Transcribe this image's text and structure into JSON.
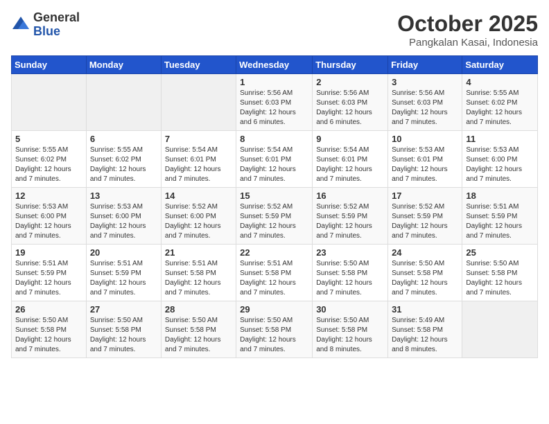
{
  "header": {
    "logo_general": "General",
    "logo_blue": "Blue",
    "month": "October 2025",
    "location": "Pangkalan Kasai, Indonesia"
  },
  "days_of_week": [
    "Sunday",
    "Monday",
    "Tuesday",
    "Wednesday",
    "Thursday",
    "Friday",
    "Saturday"
  ],
  "weeks": [
    [
      {
        "day": "",
        "empty": true
      },
      {
        "day": "",
        "empty": true
      },
      {
        "day": "",
        "empty": true
      },
      {
        "day": "1",
        "sunrise": "5:56 AM",
        "sunset": "6:03 PM",
        "daylight": "12 hours and 6 minutes."
      },
      {
        "day": "2",
        "sunrise": "5:56 AM",
        "sunset": "6:03 PM",
        "daylight": "12 hours and 6 minutes."
      },
      {
        "day": "3",
        "sunrise": "5:56 AM",
        "sunset": "6:03 PM",
        "daylight": "12 hours and 7 minutes."
      },
      {
        "day": "4",
        "sunrise": "5:55 AM",
        "sunset": "6:02 PM",
        "daylight": "12 hours and 7 minutes."
      }
    ],
    [
      {
        "day": "5",
        "sunrise": "5:55 AM",
        "sunset": "6:02 PM",
        "daylight": "12 hours and 7 minutes."
      },
      {
        "day": "6",
        "sunrise": "5:55 AM",
        "sunset": "6:02 PM",
        "daylight": "12 hours and 7 minutes."
      },
      {
        "day": "7",
        "sunrise": "5:54 AM",
        "sunset": "6:01 PM",
        "daylight": "12 hours and 7 minutes."
      },
      {
        "day": "8",
        "sunrise": "5:54 AM",
        "sunset": "6:01 PM",
        "daylight": "12 hours and 7 minutes."
      },
      {
        "day": "9",
        "sunrise": "5:54 AM",
        "sunset": "6:01 PM",
        "daylight": "12 hours and 7 minutes."
      },
      {
        "day": "10",
        "sunrise": "5:53 AM",
        "sunset": "6:01 PM",
        "daylight": "12 hours and 7 minutes."
      },
      {
        "day": "11",
        "sunrise": "5:53 AM",
        "sunset": "6:00 PM",
        "daylight": "12 hours and 7 minutes."
      }
    ],
    [
      {
        "day": "12",
        "sunrise": "5:53 AM",
        "sunset": "6:00 PM",
        "daylight": "12 hours and 7 minutes."
      },
      {
        "day": "13",
        "sunrise": "5:53 AM",
        "sunset": "6:00 PM",
        "daylight": "12 hours and 7 minutes."
      },
      {
        "day": "14",
        "sunrise": "5:52 AM",
        "sunset": "6:00 PM",
        "daylight": "12 hours and 7 minutes."
      },
      {
        "day": "15",
        "sunrise": "5:52 AM",
        "sunset": "5:59 PM",
        "daylight": "12 hours and 7 minutes."
      },
      {
        "day": "16",
        "sunrise": "5:52 AM",
        "sunset": "5:59 PM",
        "daylight": "12 hours and 7 minutes."
      },
      {
        "day": "17",
        "sunrise": "5:52 AM",
        "sunset": "5:59 PM",
        "daylight": "12 hours and 7 minutes."
      },
      {
        "day": "18",
        "sunrise": "5:51 AM",
        "sunset": "5:59 PM",
        "daylight": "12 hours and 7 minutes."
      }
    ],
    [
      {
        "day": "19",
        "sunrise": "5:51 AM",
        "sunset": "5:59 PM",
        "daylight": "12 hours and 7 minutes."
      },
      {
        "day": "20",
        "sunrise": "5:51 AM",
        "sunset": "5:59 PM",
        "daylight": "12 hours and 7 minutes."
      },
      {
        "day": "21",
        "sunrise": "5:51 AM",
        "sunset": "5:58 PM",
        "daylight": "12 hours and 7 minutes."
      },
      {
        "day": "22",
        "sunrise": "5:51 AM",
        "sunset": "5:58 PM",
        "daylight": "12 hours and 7 minutes."
      },
      {
        "day": "23",
        "sunrise": "5:50 AM",
        "sunset": "5:58 PM",
        "daylight": "12 hours and 7 minutes."
      },
      {
        "day": "24",
        "sunrise": "5:50 AM",
        "sunset": "5:58 PM",
        "daylight": "12 hours and 7 minutes."
      },
      {
        "day": "25",
        "sunrise": "5:50 AM",
        "sunset": "5:58 PM",
        "daylight": "12 hours and 7 minutes."
      }
    ],
    [
      {
        "day": "26",
        "sunrise": "5:50 AM",
        "sunset": "5:58 PM",
        "daylight": "12 hours and 7 minutes."
      },
      {
        "day": "27",
        "sunrise": "5:50 AM",
        "sunset": "5:58 PM",
        "daylight": "12 hours and 7 minutes."
      },
      {
        "day": "28",
        "sunrise": "5:50 AM",
        "sunset": "5:58 PM",
        "daylight": "12 hours and 7 minutes."
      },
      {
        "day": "29",
        "sunrise": "5:50 AM",
        "sunset": "5:58 PM",
        "daylight": "12 hours and 7 minutes."
      },
      {
        "day": "30",
        "sunrise": "5:50 AM",
        "sunset": "5:58 PM",
        "daylight": "12 hours and 8 minutes."
      },
      {
        "day": "31",
        "sunrise": "5:49 AM",
        "sunset": "5:58 PM",
        "daylight": "12 hours and 8 minutes."
      },
      {
        "day": "",
        "empty": true
      }
    ]
  ]
}
